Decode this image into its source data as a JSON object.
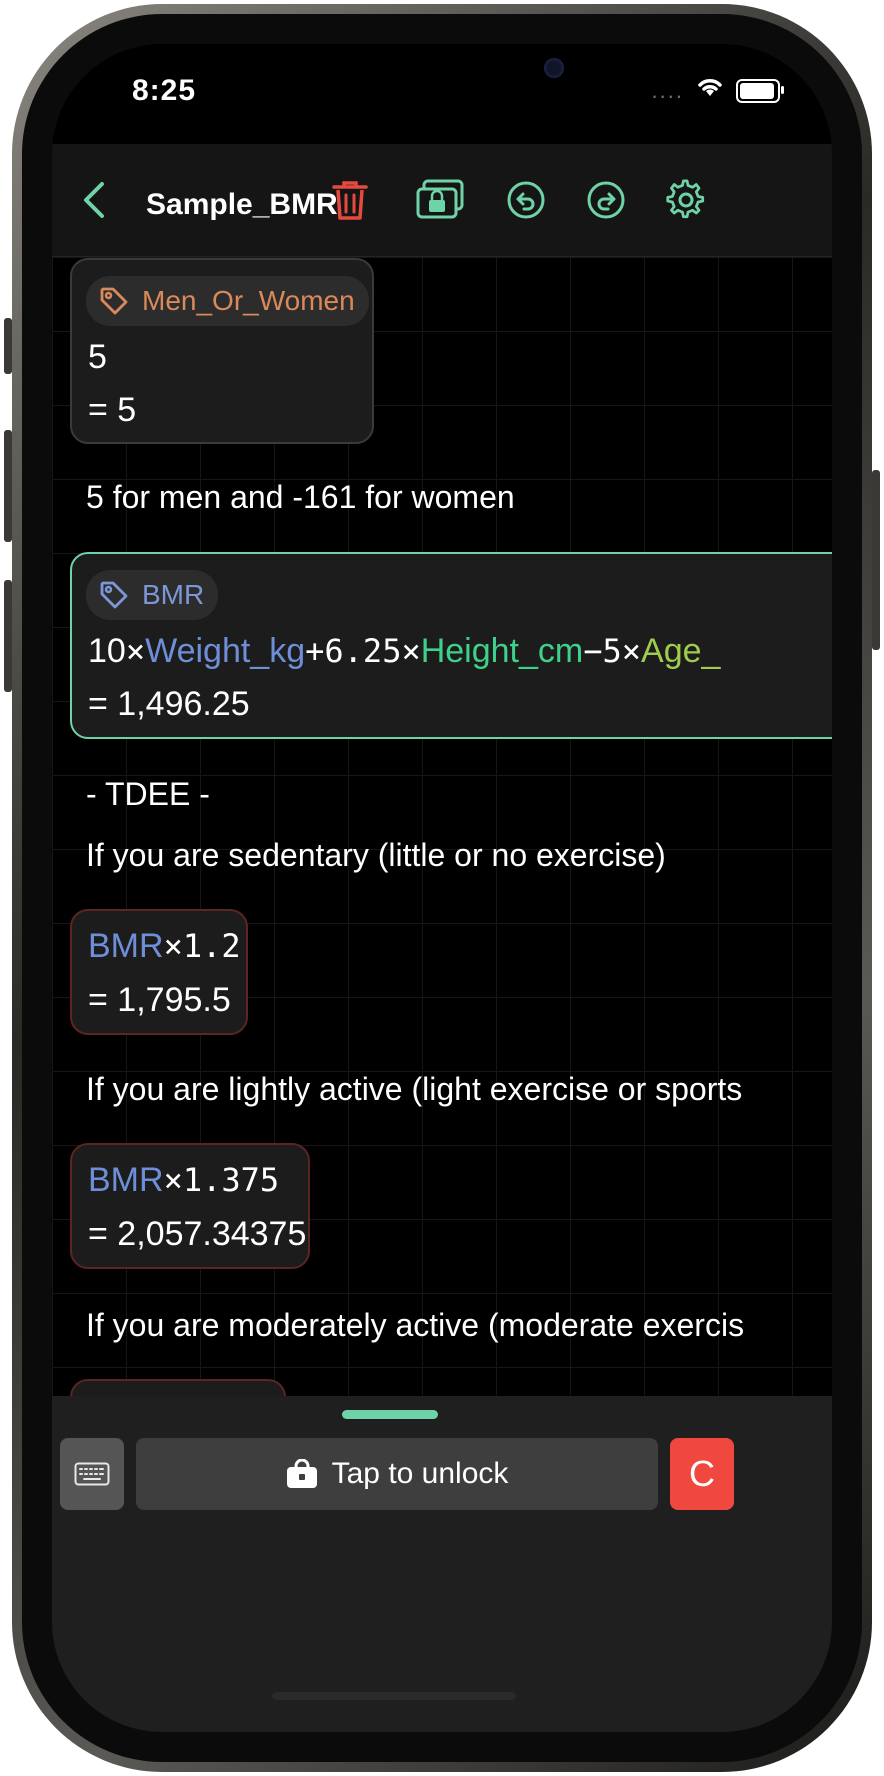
{
  "status_bar": {
    "time": "8:25",
    "signal_dots": "....",
    "wifi_icon": "wifi-icon",
    "battery_icon": "battery-icon"
  },
  "nav": {
    "title": "Sample_BMR",
    "back_icon": "chevron-left-icon",
    "icons": [
      "trash-icon",
      "lock-copy-icon",
      "undo-icon",
      "redo-icon",
      "gear-icon"
    ],
    "colors": {
      "accent": "#6fd3a8",
      "delete": "#e64a3e"
    }
  },
  "cards": [
    {
      "tag": "Men_Or_Women",
      "expression": "5",
      "result": "= 5"
    },
    {
      "tag": "BMR",
      "expr_num1": "10",
      "times1": "×",
      "var1": "Weight_kg",
      "plus": "+",
      "num2": "6.25",
      "times2": "×",
      "var2": "Height_cm",
      "minus": "−",
      "num3": "5",
      "times3": "×",
      "var3": "Age_",
      "result": "= 1,496.25"
    },
    {
      "var": "BMR",
      "op": "×1.2",
      "result": "= 1,795.5"
    },
    {
      "var": "BMR",
      "op": "×1.375",
      "result": "= 2,057.34375"
    }
  ],
  "notes": {
    "men_women": "5 for men and -161 for women",
    "tdee": "- TDEE -",
    "sedentary": "If you are sedentary (little or no exercise)",
    "light": "If you are lightly active (light exercise or sports",
    "moderate": "If you are moderately active (moderate exercis"
  },
  "bottom_bar": {
    "keyboard_icon": "keyboard-icon",
    "unlock_label": "Tap to unlock",
    "lock_icon": "lock-icon",
    "clear_label": "C"
  }
}
